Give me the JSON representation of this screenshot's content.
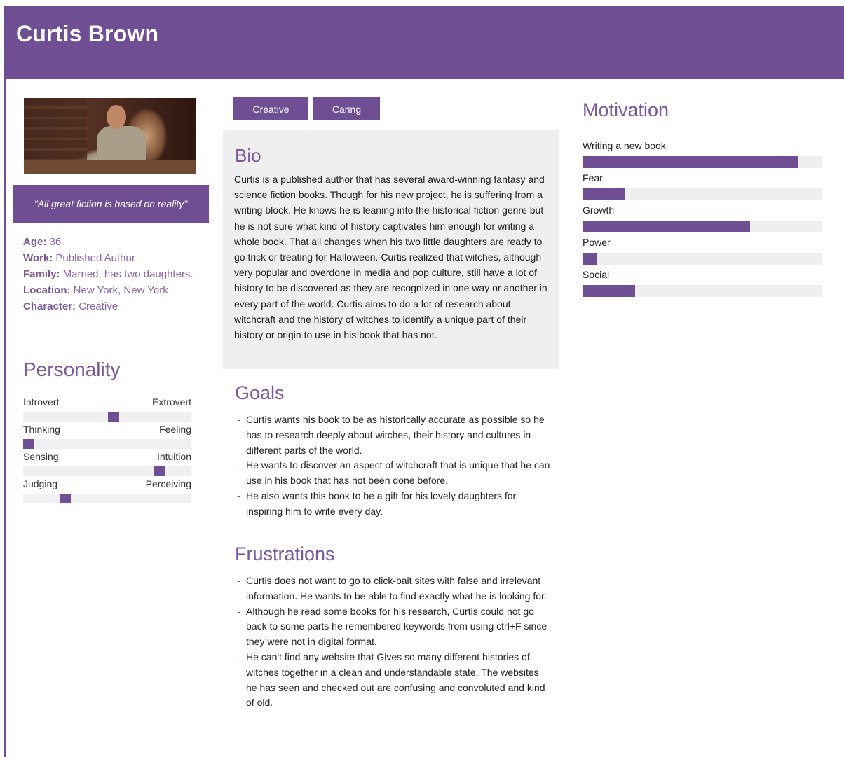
{
  "header": {
    "name": "Curtis Brown"
  },
  "profile": {
    "photo_alt": "Photo of a man writing at a desk",
    "quote": "\"All great fiction is based on reality\"",
    "facts": [
      {
        "label": "Age:",
        "value": " 36"
      },
      {
        "label": "Work:",
        "value": " Published Author"
      },
      {
        "label": "Family:",
        "value": " Married, has two daughters."
      },
      {
        "label": "Location:",
        "value": " New York, New York"
      },
      {
        "label": "Character:",
        "value": " Creative"
      }
    ]
  },
  "personality": {
    "title": "Personality",
    "scales": [
      {
        "left": "Introvert",
        "right": "Extrovert",
        "position": 0.54
      },
      {
        "left": "Thinking",
        "right": "Feeling",
        "position": 0.0
      },
      {
        "left": "Sensing",
        "right": "Intuition",
        "position": 0.83
      },
      {
        "left": "Judging",
        "right": "Perceiving",
        "position": 0.23
      }
    ]
  },
  "tags": [
    "Creative",
    "Caring"
  ],
  "bio": {
    "title": "Bio",
    "text": "Curtis is a published author that has several award-winning fantasy and science fiction books. Though for his new project, he is suffering from a writing block. He knows he is leaning into the historical fiction genre but he is not sure what kind of history captivates him enough for writing a whole book. That all changes when his two little daughters are ready to go trick or treating for Halloween. Curtis realized that witches, although very popular and overdone in media and pop culture, still have a lot of history to be discovered as they are recognized in one way or another in every part of the world. Curtis aims to do a lot of research about witchcraft and the history of witches to identify a unique part of their history or origin to use in his book that has not."
  },
  "goals": {
    "title": "Goals",
    "items": [
      "Curtis wants his book to be as historically accurate as possible so he has to research deeply about witches, their history and cultures in different parts of the world.",
      "He wants to discover an aspect of witchcraft that is unique that he can use in his book that has not been done before.",
      "He also wants this book to be a gift for his lovely daughters for inspiring him to write every day."
    ]
  },
  "frustrations": {
    "title": "Frustrations",
    "items": [
      "Curtis does not want to go to click-bait sites with false and irrelevant information. He wants to be able to find exactly what he is looking for.",
      "Although he read some books for his research, Curtis could not go back to some parts he remembered keywords from using ctrl+F since they were not in digital format.",
      "He can't find any website that Gives so many different histories of witches together in a clean and understandable state. The websites he has seen and checked out are confusing and convoluted and kind of old."
    ]
  },
  "motivation": {
    "title": "Motivation",
    "items": [
      {
        "label": "Writing a new book",
        "level": 0.9
      },
      {
        "label": "Fear",
        "level": 0.18
      },
      {
        "label": "Growth",
        "level": 0.7
      },
      {
        "label": "Power",
        "level": 0.06
      },
      {
        "label": "Social",
        "level": 0.22
      }
    ]
  },
  "colors": {
    "accent": "#6f4e94",
    "track": "#efefef",
    "heading": "#7a5899"
  }
}
